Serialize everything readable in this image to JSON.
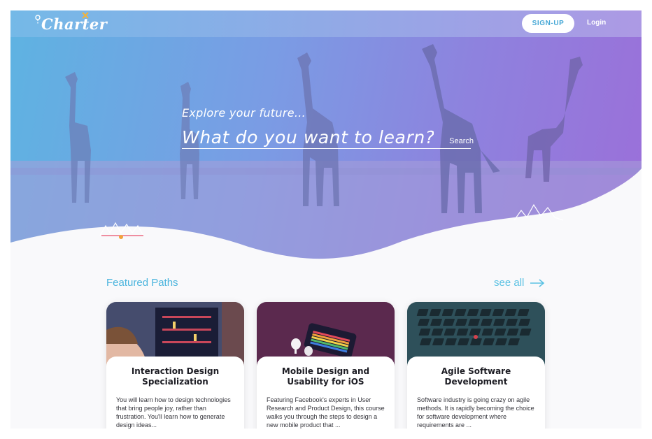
{
  "navbar": {
    "logo_text": "Charter",
    "signup_label": "SIGN-UP",
    "login_label": "Login"
  },
  "hero": {
    "tagline": "Explore your future...",
    "search_placeholder": "What do you want to learn?",
    "search_button": "Search"
  },
  "featured": {
    "title": "Featured Paths",
    "see_all": "see all",
    "cards": [
      {
        "title": "Interaction Design Specialization",
        "description": "You will learn how to design technologies that bring people joy, rather than frustration. You'll learn how to generate design ideas..."
      },
      {
        "title": "Mobile Design and Usability for iOS",
        "description": "Featuring Facebook's experts in User Research and Product Design, this course walks you through the steps to design a new mobile product that ..."
      },
      {
        "title": "Agile Software Development",
        "description": "Software industry is going crazy on agile methods.  It is rapidly becoming the choice for software development where requirements are ..."
      }
    ]
  },
  "colors": {
    "accent": "#4ab4dd",
    "hero_start": "#5eb3e2",
    "hero_end": "#9b6fd9",
    "background": "#f9f9fb"
  }
}
